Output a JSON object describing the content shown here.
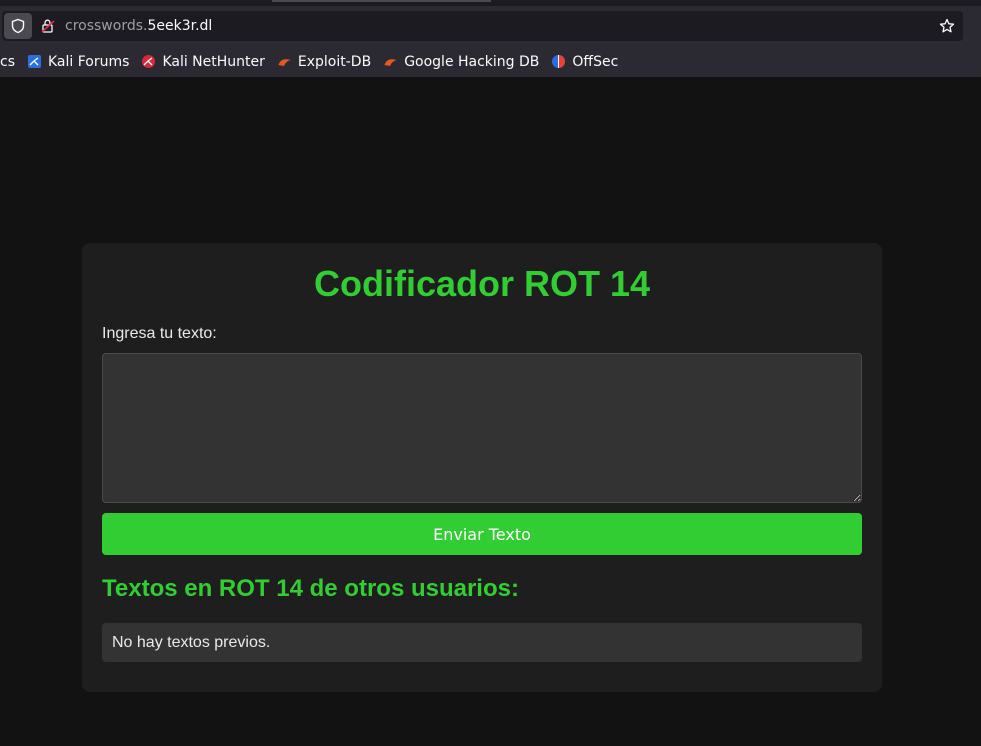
{
  "browser": {
    "url_subdomain": "crosswords.",
    "url_domain": "5eek3r.dl",
    "bookmarks": [
      {
        "label": "cs",
        "icon": "none"
      },
      {
        "label": "Kali Forums",
        "icon": "kali-forums-icon"
      },
      {
        "label": "Kali NetHunter",
        "icon": "kali-nethunter-icon"
      },
      {
        "label": "Exploit-DB",
        "icon": "exploit-db-icon"
      },
      {
        "label": "Google Hacking DB",
        "icon": "google-hacking-db-icon"
      },
      {
        "label": "OffSec",
        "icon": "offsec-icon"
      }
    ]
  },
  "page": {
    "title": "Codificador ROT 14",
    "input_label": "Ingresa tu texto:",
    "input_value": "",
    "submit_label": "Enviar Texto",
    "previous_heading": "Textos en ROT 14 de otros usuarios:",
    "no_previous": "No hay textos previos."
  },
  "colors": {
    "accent": "#32cd32",
    "background": "#121212",
    "card": "#1e1e1e",
    "field": "#333333"
  }
}
